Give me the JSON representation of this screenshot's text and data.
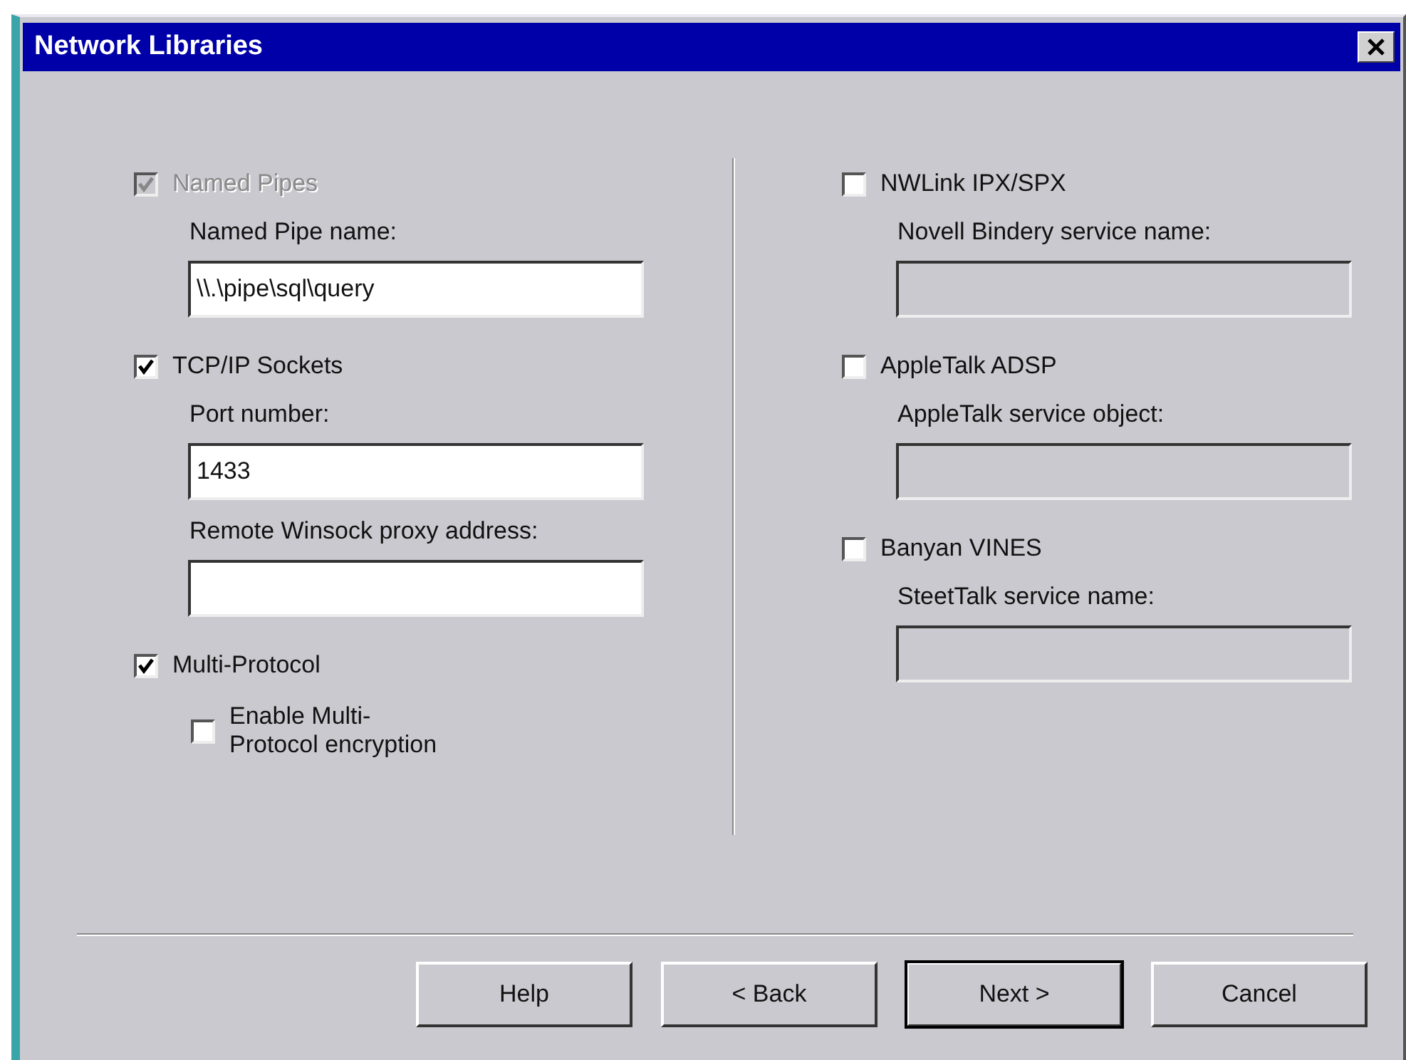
{
  "window": {
    "title": "Network Libraries"
  },
  "left_column": [
    {
      "kind": "checkbox",
      "label": "Named Pipes",
      "checked": true,
      "disabled": true
    },
    {
      "kind": "label",
      "text": "Named Pipe name:"
    },
    {
      "kind": "field",
      "value": "\\\\.\\pipe\\sql\\query",
      "disabled": false
    },
    {
      "kind": "checkbox",
      "label": "TCP/IP Sockets",
      "checked": true,
      "disabled": false
    },
    {
      "kind": "label",
      "text": "Port number:"
    },
    {
      "kind": "field",
      "value": "1433",
      "disabled": false
    },
    {
      "kind": "label",
      "text": "Remote Winsock proxy address:"
    },
    {
      "kind": "field",
      "disabled": false
    },
    {
      "kind": "checkbox",
      "label": "Multi-Protocol",
      "checked": true,
      "disabled": false
    },
    {
      "kind": "subcheckbox",
      "label": "Enable Multi-Protocol encryption",
      "checked": false,
      "disabled": false
    }
  ],
  "right_column": [
    {
      "kind": "checkbox",
      "label": "NWLink IPX/SPX",
      "checked": false,
      "disabled": false
    },
    {
      "kind": "label",
      "text": "Novell Bindery service name:"
    },
    {
      "kind": "field",
      "disabled": true
    },
    {
      "kind": "checkbox",
      "label": "AppleTalk ADSP",
      "checked": false,
      "disabled": false
    },
    {
      "kind": "label",
      "text": "AppleTalk service object:"
    },
    {
      "kind": "field",
      "disabled": true
    },
    {
      "kind": "checkbox",
      "label": "Banyan VINES",
      "checked": false,
      "disabled": false
    },
    {
      "kind": "label",
      "text": "SteetTalk service name:"
    },
    {
      "kind": "field",
      "disabled": true
    }
  ],
  "buttons": [
    {
      "label": "Help",
      "default": false
    },
    {
      "label": "< Back",
      "default": false
    },
    {
      "label": "Next >",
      "default": true
    },
    {
      "label": "Cancel",
      "default": false
    }
  ]
}
